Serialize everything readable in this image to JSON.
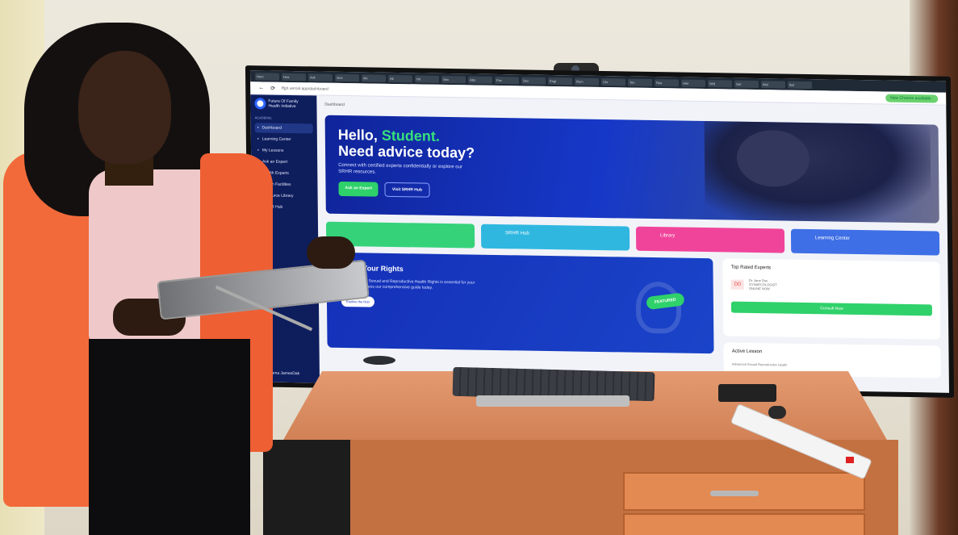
{
  "browser": {
    "tabs": [
      "Hom",
      "Hea",
      "Ask",
      "Gmi",
      "Wi-",
      "All",
      "Hit",
      "Sex",
      "Abo",
      "Fac",
      "Sex",
      "Engl",
      "Rem",
      "Chr",
      "Ten",
      "Rea",
      "Hier",
      "Wid",
      "Get",
      "Wel",
      "Ikel"
    ],
    "url": "ffgh.vercel.app/dashboard",
    "chrome_button": "New Chrome available :"
  },
  "app": {
    "logo_line1": "Future Of Family",
    "logo_line2": "Health Initiative",
    "section_label": "ACADEMIC",
    "nav": [
      {
        "icon": "grid-icon",
        "label": "Dashboard",
        "active": true
      },
      {
        "icon": "book-icon",
        "label": "Learning Center",
        "active": false
      },
      {
        "icon": "lessons-icon",
        "label": "My Lessons",
        "active": false
      },
      {
        "icon": "chat-icon",
        "label": "Ask an Expert",
        "active": false
      },
      {
        "icon": "expert-icon",
        "label": "Health Experts",
        "active": false
      },
      {
        "icon": "pin-icon",
        "label": "Health Facilities",
        "active": false
      },
      {
        "icon": "library-icon",
        "label": "Resource Library",
        "active": false
      },
      {
        "icon": "hub-icon",
        "label": "SRHR Hub",
        "active": false
      }
    ],
    "user_name": "Kiama JamesDak",
    "breadcrumb": "Dashboard",
    "hero": {
      "greeting": "Hello,",
      "name": "Student.",
      "title": "Need advice today?",
      "subtitle": "Connect with certified experts confidentially or explore our SRHR resources.",
      "primary_button": "Ask an Expert",
      "secondary_button": "Visit SRHR Hub"
    },
    "quick_cards": [
      {
        "label": "",
        "color": "#35d27a"
      },
      {
        "label": "SRHR Hub",
        "color": "#2fb7e0"
      },
      {
        "label": "Library",
        "color": "#f0449a"
      },
      {
        "label": "Learning Center",
        "color": "#3f6fe6"
      }
    ],
    "rights": {
      "title": "Know Your Rights",
      "text": "Understanding Sexual and Reproductive Health Rights is essential for your well-being. Access our comprehensive guide today.",
      "button": "Explore the Hub",
      "badge": "FEATURED"
    },
    "experts": {
      "title": "Top Rated Experts",
      "initials": "DD",
      "name": "Dr. Jane Doe",
      "role": "GYNAECOLOGIST",
      "status": "ONLINE NOW",
      "button": "Consult Now"
    },
    "lesson": {
      "title": "Active Lesson",
      "item": "Advanced Sexual Reproductive Health"
    }
  }
}
